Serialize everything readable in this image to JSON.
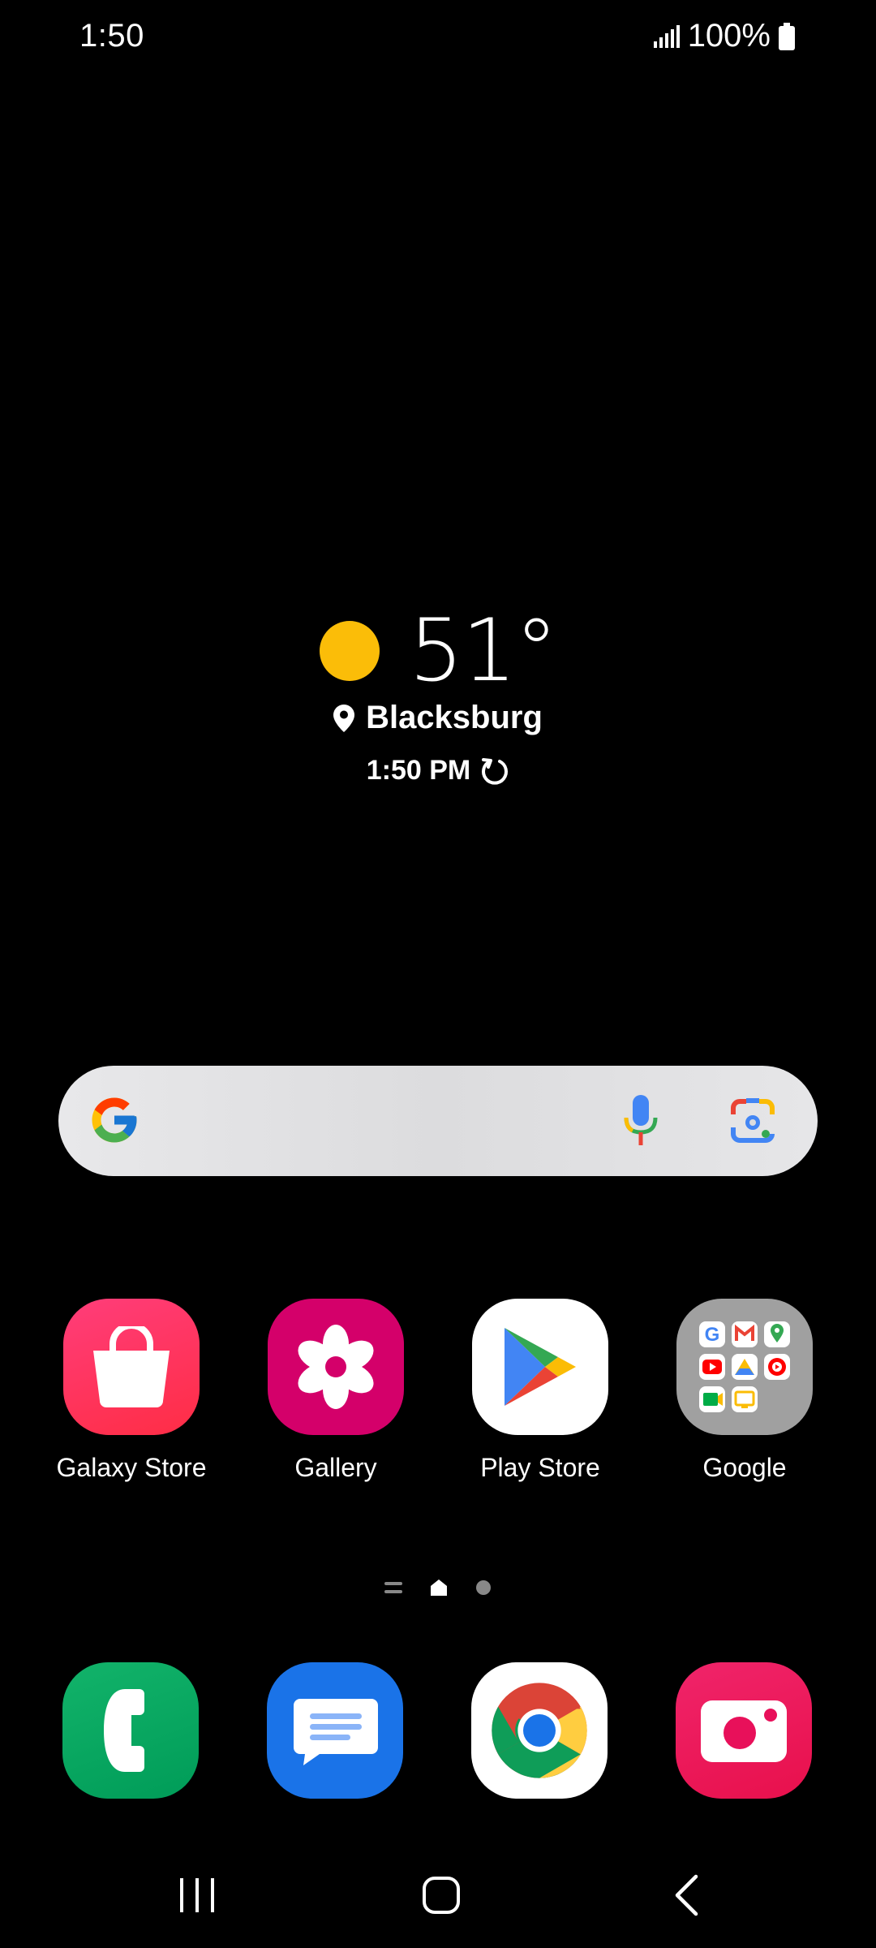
{
  "status_bar": {
    "time": "1:50",
    "battery_text": "100%",
    "icons": [
      "signal-icon",
      "battery-icon"
    ]
  },
  "weather": {
    "temperature": "51°",
    "location": "Blacksburg",
    "updated_time": "1:50 PM",
    "icons": [
      "sun-icon",
      "location-pin-icon",
      "refresh-icon"
    ],
    "sun_color": "#fbbd08"
  },
  "search": {
    "icons": [
      "google-logo-icon",
      "microphone-icon",
      "google-lens-icon"
    ]
  },
  "apps": [
    {
      "label": "Galaxy Store",
      "icon": "shopping-bag-icon",
      "color": "#ff2d55"
    },
    {
      "label": "Gallery",
      "icon": "flower-icon",
      "color": "#d4006a"
    },
    {
      "label": "Play Store",
      "icon": "play-triangle-icon",
      "color": "#ffffff"
    },
    {
      "label": "Google",
      "icon": "folder-icon",
      "color": "#9e9e9e"
    }
  ],
  "dock": [
    {
      "name": "phone",
      "icon": "phone-icon",
      "color": "#0aa560"
    },
    {
      "name": "messages",
      "icon": "message-icon",
      "color": "#1a73e8"
    },
    {
      "name": "chrome",
      "icon": "chrome-icon",
      "color": "#ffffff"
    },
    {
      "name": "camera",
      "icon": "camera-icon",
      "color": "#e8105a"
    }
  ],
  "nav_bar": {
    "icons": [
      "recents-icon",
      "home-icon",
      "back-icon"
    ]
  }
}
